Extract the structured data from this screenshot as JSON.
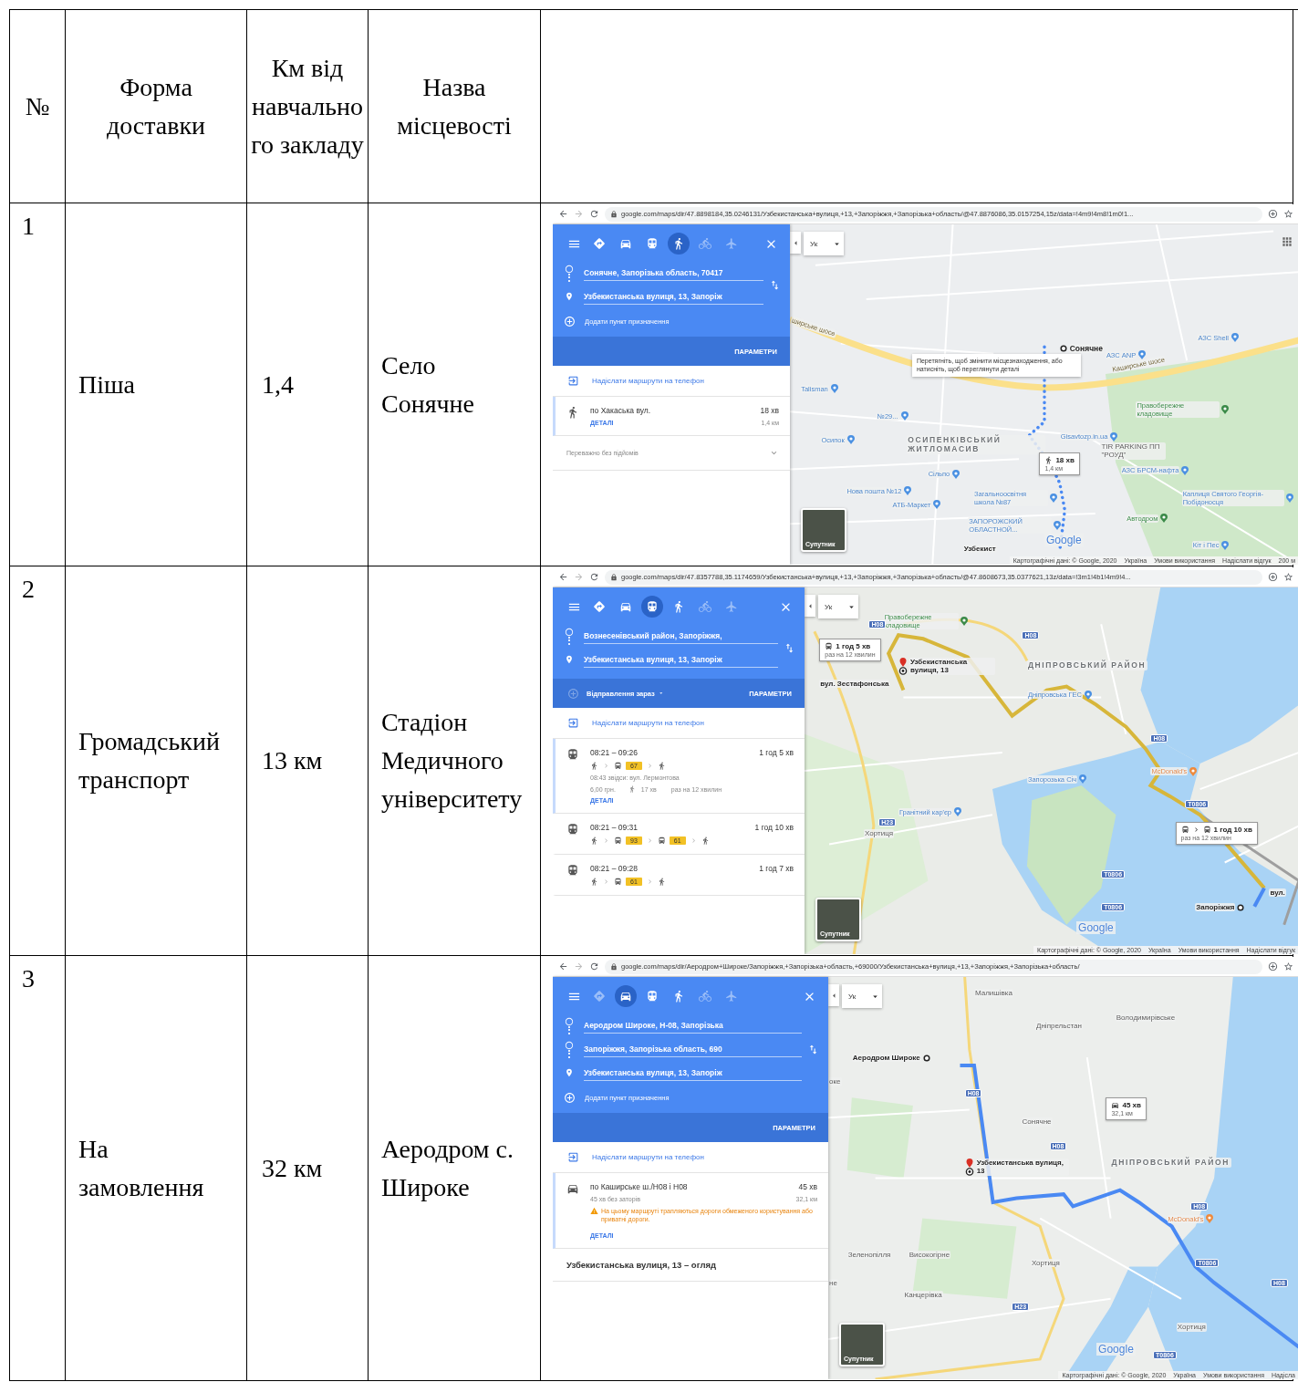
{
  "table": {
    "columns": [
      "№",
      "Форма доставки",
      "Км від навчального закладу",
      "Назва місцевості"
    ],
    "rows": [
      {
        "number": "1",
        "delivery": "Піша",
        "distance": "1,4",
        "place": "Село Сонячне",
        "screenshot": {
          "url": "google.com/maps/dir/47.8898184,35.0246131/Узбекистанська+вулиця,+13,+Запоріжжя,+Запорізька+область/@47.8876086,35.0157254,15z/data=!4m9!4m8!1m0!1...",
          "modes": [
            {
              "kind": "best",
              "selected": false,
              "dimmed": false
            },
            {
              "kind": "car",
              "selected": false,
              "dimmed": false
            },
            {
              "kind": "transit",
              "selected": false,
              "dimmed": false
            },
            {
              "kind": "walk",
              "selected": true,
              "dimmed": false
            },
            {
              "kind": "bike",
              "selected": false,
              "dimmed": true
            },
            {
              "kind": "flight",
              "selected": false,
              "dimmed": true
            }
          ],
          "stops": [
            {
              "kind": "origin",
              "value": "Сонячне, Запорізька область, 70417"
            },
            {
              "kind": "destination",
              "value": "Узбекистанська вулиця, 13, Запоріж"
            }
          ],
          "add_stop": "Додати пункт призначення",
          "options": "ПАРАМЕТРИ",
          "send": "Надіслати маршрути на телефон",
          "routes": [
            {
              "kind": "walk",
              "selected": true,
              "title": "по Хакаська вул.",
              "duration": "18 хв",
              "distance": "1,4 км",
              "details": "ДЕТАЛІ"
            }
          ],
          "footer": {
            "kind": "filter",
            "text": "Переважно без підйомів"
          },
          "map": {
            "language": "Ук",
            "apps_button": true,
            "labels": [
              {
                "kind": "road",
                "text": "ширське шосе"
              },
              {
                "kind": "stop-lead",
                "text": "Сонячне"
              },
              {
                "kind": "poi",
                "text": "АЗС ANP"
              },
              {
                "kind": "poi",
                "text": "АЗС Shell"
              },
              {
                "kind": "road",
                "text": "Каширське шосе"
              },
              {
                "kind": "note",
                "text": "Перетягніть, щоб змінити місцезнаходження, або натисніть, щоб переглянути деталі"
              },
              {
                "kind": "poi",
                "text": "Talisman"
              },
              {
                "kind": "poi",
                "text": "№29..."
              },
              {
                "kind": "poi",
                "text": "Осипок"
              },
              {
                "kind": "district",
                "text": "ОСИПЕНКІВСЬКИЙ ЖИТЛОМАСИВ"
              },
              {
                "kind": "poi",
                "text": "Gisavtozp.in.ua"
              },
              {
                "kind": "place",
                "text": "TIR PARKING ПП \"РОУД\""
              },
              {
                "kind": "park",
                "text": "Правобережне кладовище"
              },
              {
                "kind": "poi",
                "text": "Сільпо"
              },
              {
                "kind": "poi",
                "text": "АЗС БРСМ-нафта"
              },
              {
                "kind": "poi",
                "text": "Нова пошта №12"
              },
              {
                "kind": "poi",
                "text": "Загальноосвітня школа №87"
              },
              {
                "kind": "poi",
                "text": "Каплиця Святого Георгія-Побідоносця"
              },
              {
                "kind": "poi",
                "text": "АТБ-Маркет"
              },
              {
                "kind": "park",
                "text": "Автодром"
              },
              {
                "kind": "poi",
                "text": "ЗАПОРОЖСКИЙ ОБЛАСТНОЙ..."
              },
              {
                "kind": "bold",
                "text": "Узбекист"
              },
              {
                "kind": "poi",
                "text": "Кіт і Пес"
              }
            ],
            "callouts": [
              {
                "kind": "walk",
                "duration": "18 хв",
                "detail": "1,4 км"
              }
            ],
            "satellite": "Супутник",
            "logo": "Google",
            "attribution": [
              "Картографічні дані: © Google, 2020",
              "Україна",
              "Умови використання",
              "Надіслати відгук",
              "200 м"
            ]
          }
        }
      },
      {
        "number": "2",
        "delivery": "Громадський транспорт",
        "distance": "13 км",
        "place": "Стадіон Медичного університету",
        "screenshot": {
          "url": "google.com/maps/dir/47.8357788,35.1174659/Узбекистанська+вулиця,+13,+Запоріжжя,+Запорізька+область/@47.8608673,35.0377621,13z/data=!3m1!4b1!4m9!4...",
          "modes": [
            {
              "kind": "best",
              "selected": false,
              "dimmed": false
            },
            {
              "kind": "car",
              "selected": false,
              "dimmed": false
            },
            {
              "kind": "transit",
              "selected": true,
              "dimmed": false
            },
            {
              "kind": "walk",
              "selected": false,
              "dimmed": false
            },
            {
              "kind": "bike",
              "selected": false,
              "dimmed": true
            },
            {
              "kind": "flight",
              "selected": false,
              "dimmed": true
            }
          ],
          "stops": [
            {
              "kind": "origin",
              "value": "Вознесенівський район, Запоріжжя,"
            },
            {
              "kind": "destination",
              "value": "Узбекистанська вулиця, 13, Запоріж"
            }
          ],
          "departure": "Відправлення зараз",
          "options": "ПАРАМЕТРИ",
          "send": "Надіслати маршрути на телефон",
          "routes": [
            {
              "kind": "transit",
              "selected": true,
              "times": "08:21 – 09:26",
              "duration": "1 год 5 хв",
              "steps": [
                {
                  "kind": "walk"
                },
                {
                  "kind": "bus",
                  "line": "67"
                },
                {
                  "kind": "walk"
                }
              ],
              "note": "08:43 звідси: вул. Лермонтова",
              "fare": "6,00 грн.",
              "walk": "17 хв",
              "frequency": "раз на 12 хвилин",
              "details": "ДЕТАЛІ"
            },
            {
              "kind": "transit",
              "selected": false,
              "times": "08:21 – 09:31",
              "duration": "1 год 10 хв",
              "steps": [
                {
                  "kind": "walk"
                },
                {
                  "kind": "bus",
                  "line": "93"
                },
                {
                  "kind": "bus",
                  "line": "61"
                },
                {
                  "kind": "walk"
                }
              ]
            },
            {
              "kind": "transit",
              "selected": false,
              "times": "08:21 – 09:28",
              "duration": "1 год 7 хв",
              "steps": [
                {
                  "kind": "walk"
                },
                {
                  "kind": "bus",
                  "line": "61"
                },
                {
                  "kind": "walk"
                }
              ]
            }
          ],
          "map": {
            "language": "Ук",
            "labels": [
              {
                "kind": "park",
                "text": "Правобережне кладовище"
              },
              {
                "kind": "target",
                "text": "Узбекистанська вулиця, 13"
              },
              {
                "kind": "bold",
                "text": "вул. Зестафонська"
              },
              {
                "kind": "district",
                "text": "ДНІПРОВСЬКИЙ РАЙОН"
              },
              {
                "kind": "poi",
                "text": "Дніпровська ГЕС"
              },
              {
                "kind": "poi",
                "text": "Запорозька Січ"
              },
              {
                "kind": "food",
                "text": "McDonald's"
              },
              {
                "kind": "poi",
                "text": "Гранітний кар'єр"
              },
              {
                "kind": "place",
                "text": "Хортиця"
              },
              {
                "kind": "stop",
                "text": "Запоріжжя"
              },
              {
                "kind": "bold",
                "text": "вул."
              },
              {
                "kind": "shield",
                "text": "H08"
              },
              {
                "kind": "shield",
                "text": "H08"
              },
              {
                "kind": "shield",
                "text": "H08"
              },
              {
                "kind": "shield",
                "text": "T0806"
              },
              {
                "kind": "shield",
                "text": "T0806"
              },
              {
                "kind": "shield",
                "text": "T0806"
              },
              {
                "kind": "shield",
                "text": "H23"
              }
            ],
            "callouts": [
              {
                "kind": "bus",
                "duration": "1 год 5 хв",
                "detail": "раз на 12 хвилин"
              },
              {
                "kind": "transfer",
                "duration": "1 год 10 хв",
                "detail": "раз на 12 хвилин"
              }
            ],
            "satellite": "Супутник",
            "logo": "Google",
            "attribution": [
              "Картографічні дані: © Google, 2020",
              "Україна",
              "Умови використання",
              "Надіслати відгук"
            ]
          }
        }
      },
      {
        "number": "3",
        "delivery": "На замовлення",
        "distance": "32 км",
        "place": "Аеродром с. Широке",
        "screenshot": {
          "url": "google.com/maps/dir/Аеродром+Широке/Запоріжжя,+Запорізька+область,+69000/Узбекистанська+вулиця,+13,+Запоріжжя,+Запорізька+область/",
          "modes": [
            {
              "kind": "best",
              "selected": false,
              "dimmed": true
            },
            {
              "kind": "car",
              "selected": true,
              "dimmed": false
            },
            {
              "kind": "transit",
              "selected": false,
              "dimmed": false
            },
            {
              "kind": "walk",
              "selected": false,
              "dimmed": false
            },
            {
              "kind": "bike",
              "selected": false,
              "dimmed": true
            },
            {
              "kind": "flight",
              "selected": false,
              "dimmed": true
            }
          ],
          "stops": [
            {
              "kind": "origin",
              "value": "Аеродром Широке, Н-08, Запорізька"
            },
            {
              "kind": "waypoint",
              "value": "Запоріжжя, Запорізька область, 690"
            },
            {
              "kind": "destination",
              "value": "Узбекистанська вулиця, 13, Запоріж"
            }
          ],
          "add_stop": "Додати пункт призначення",
          "options": "ПАРАМЕТРИ",
          "send": "Надіслати маршрути на телефон",
          "routes": [
            {
              "kind": "car",
              "selected": true,
              "title": "по Каширське ш./Н08 і Н08",
              "duration": "45 хв",
              "subtitle": "45 хв без заторів",
              "distance": "32,1 км",
              "warning": "На цьому маршруті трапляються дороги обмеженого користування або приватні дороги.",
              "details": "ДЕТАЛІ"
            }
          ],
          "footer": {
            "kind": "overview",
            "text": "Узбекистанська вулиця, 13 – огляд"
          },
          "map": {
            "language": "Ук",
            "labels": [
              {
                "kind": "place",
                "text": "Малишівка"
              },
              {
                "kind": "place",
                "text": "Дніпрельстан"
              },
              {
                "kind": "place",
                "text": "Володимирівське"
              },
              {
                "kind": "stop",
                "text": "Аеродром Широке"
              },
              {
                "kind": "place",
                "text": "оке"
              },
              {
                "kind": "place",
                "text": "Сонячне"
              },
              {
                "kind": "target",
                "text": "Узбекистанська вулиця, 13"
              },
              {
                "kind": "district",
                "text": "ДНІПРОВСЬКИЙ РАЙОН"
              },
              {
                "kind": "food",
                "text": "McDonald's"
              },
              {
                "kind": "place",
                "text": "Зеленопілля"
              },
              {
                "kind": "place",
                "text": "Високогірне"
              },
              {
                "kind": "place",
                "text": "Хортиця"
              },
              {
                "kind": "place",
                "text": "не"
              },
              {
                "kind": "place",
                "text": "Канцерівка"
              },
              {
                "kind": "place",
                "text": "Хортиця"
              },
              {
                "kind": "shield",
                "text": "H08"
              },
              {
                "kind": "shield",
                "text": "H08"
              },
              {
                "kind": "shield",
                "text": "H08"
              },
              {
                "kind": "shield",
                "text": "T0806"
              },
              {
                "kind": "shield",
                "text": "H08"
              },
              {
                "kind": "shield",
                "text": "H23"
              },
              {
                "kind": "shield",
                "text": "T0806"
              }
            ],
            "callouts": [
              {
                "kind": "car",
                "duration": "45 хв",
                "detail": "32,1 км"
              }
            ],
            "satellite": "Супутник",
            "logo": "Google",
            "attribution": [
              "Картографічні дані: © Google, 2020",
              "Україна",
              "Умови використання",
              "Надісла"
            ]
          }
        }
      }
    ]
  }
}
